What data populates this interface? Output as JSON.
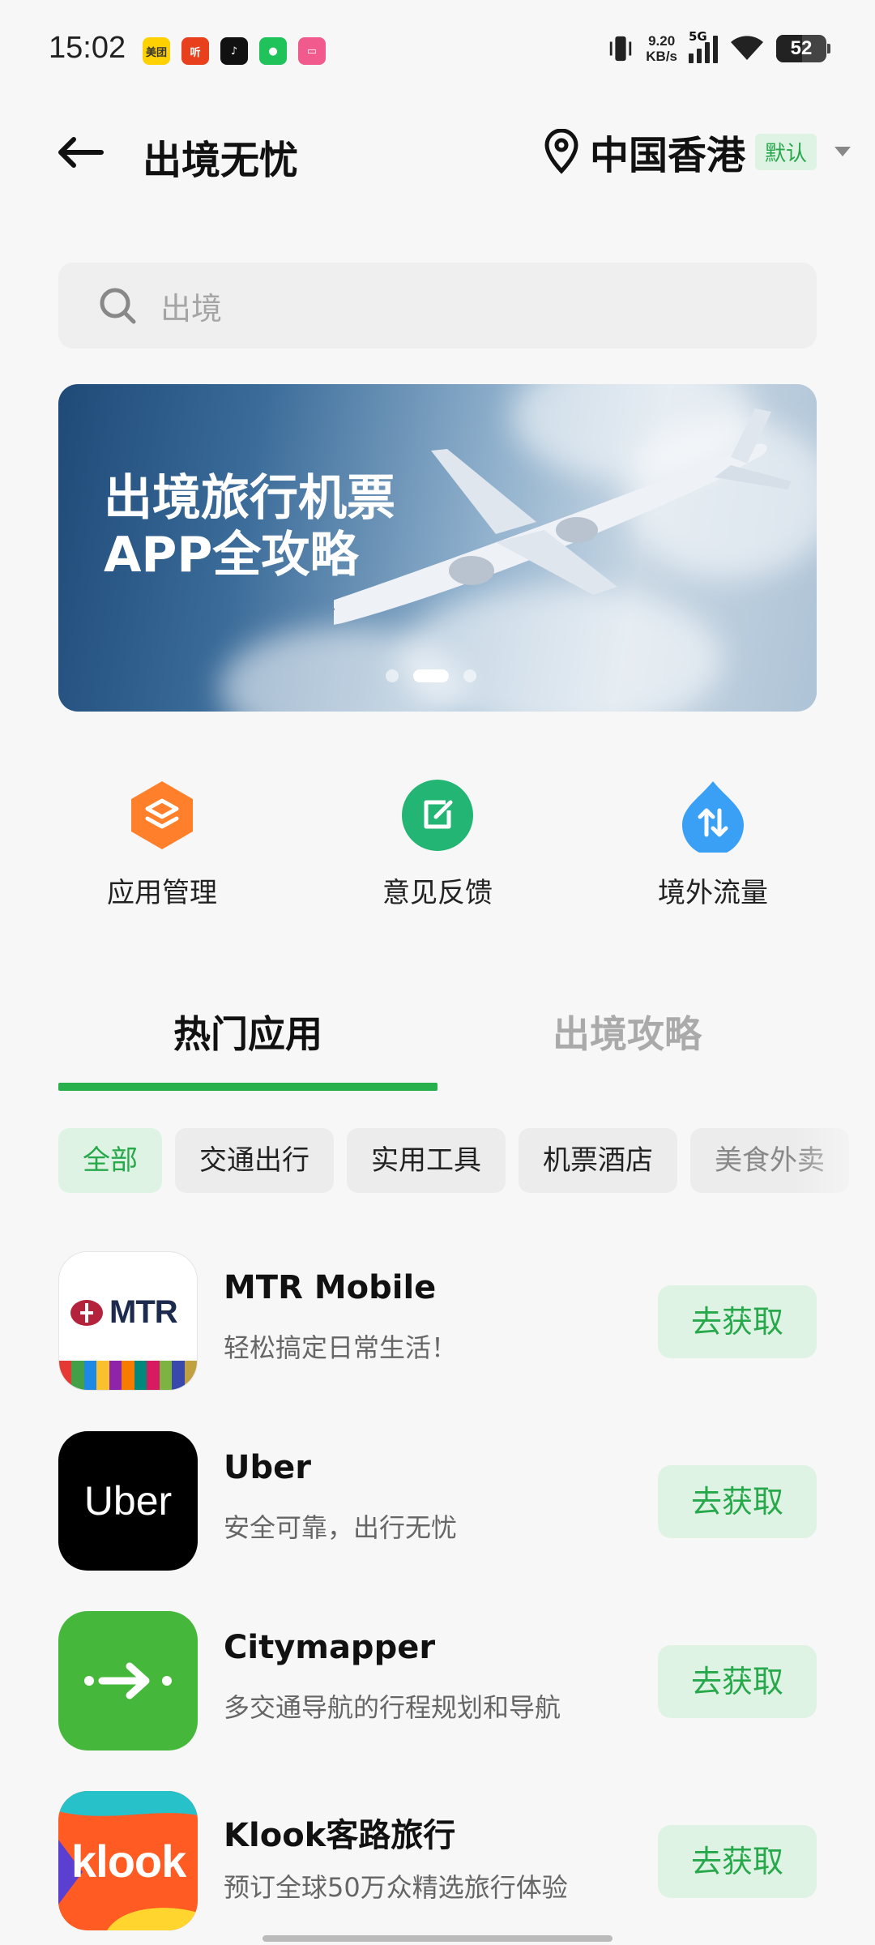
{
  "status_bar": {
    "time": "15:02",
    "notification_icons": [
      {
        "name": "meituan-icon",
        "label": "美团",
        "color": "#ffd100",
        "text_color": "#333"
      },
      {
        "name": "ting-icon",
        "label": "听",
        "color": "#e8401c",
        "text_color": "#fff"
      },
      {
        "name": "tiktok-icon",
        "label": "♪",
        "color": "#111111",
        "text_color": "#fff"
      },
      {
        "name": "wechat-icon",
        "label": "●",
        "color": "#1fc35a",
        "text_color": "#fff"
      },
      {
        "name": "app-pink-icon",
        "label": "▭",
        "color": "#f05a8c",
        "text_color": "#fff"
      }
    ],
    "net_speed_value": "9.20",
    "net_speed_unit": "KB/s",
    "network_type": "5G",
    "battery": "52",
    "battery_level": 0.52
  },
  "header": {
    "title": "出境无忧",
    "location": "中国香港",
    "location_badge": "默认"
  },
  "search": {
    "placeholder": "出境"
  },
  "banner": {
    "line1": "出境旅行机票",
    "line2": "APP全攻略",
    "active_slide": 2,
    "slide_count": 3
  },
  "quick_actions": [
    {
      "label": "应用管理",
      "icon": "layers-icon",
      "color": "#ff7f2a"
    },
    {
      "label": "意见反馈",
      "icon": "feedback-edit-icon",
      "color": "#22b573"
    },
    {
      "label": "境外流量",
      "icon": "data-transfer-icon",
      "color": "#3aa0f5"
    }
  ],
  "tabs": {
    "active": "热门应用",
    "inactive": "出境攻略"
  },
  "categories": [
    "全部",
    "交通出行",
    "实用工具",
    "机票酒店",
    "美食外卖"
  ],
  "apps": [
    {
      "name": "MTR Mobile",
      "desc": "轻松搞定日常生活！",
      "button": "去获取",
      "logo_text": "MTR"
    },
    {
      "name": "Uber",
      "desc": "安全可靠，出行无忧",
      "button": "去获取",
      "logo_text": "Uber"
    },
    {
      "name": "Citymapper",
      "desc": "多交通导航的行程规划和导航",
      "button": "去获取"
    },
    {
      "name": "Klook客路旅行",
      "desc": "预订全球50万众精选旅行体验",
      "button": "去获取",
      "logo_text": "klook"
    }
  ],
  "colors": {
    "accent_green": "#27b04c",
    "chip_active_bg": "#dff3e5",
    "background": "#f7f7f7"
  }
}
